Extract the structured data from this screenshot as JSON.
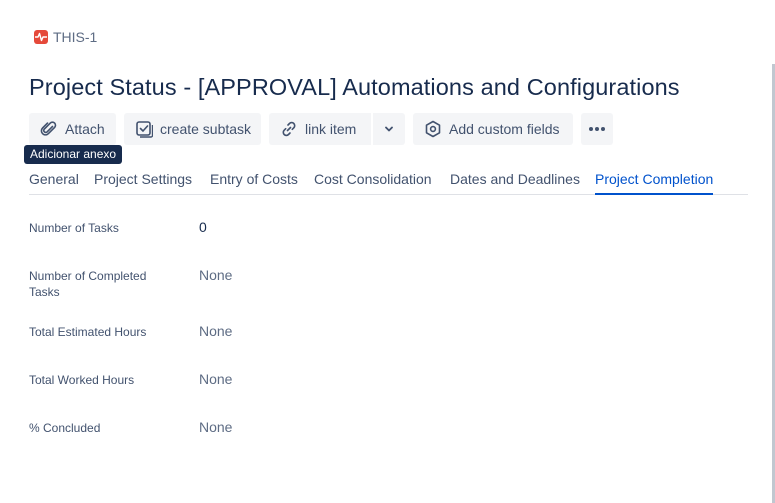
{
  "breadcrumb": {
    "issue_key": "THIS-1",
    "icon": "pulse-icon",
    "icon_color": "#e5493a"
  },
  "page": {
    "title": "Project Status - [APPROVAL] Automations and Configurations"
  },
  "toolbar": {
    "attach_label": "Attach",
    "create_subtask_label": "create subtask",
    "link_item_label": "link item",
    "add_custom_fields_label": "Add custom fields",
    "tooltip": "Adicionar anexo"
  },
  "tabs": [
    {
      "label": "General",
      "active": false
    },
    {
      "label": "Project Settings",
      "active": false
    },
    {
      "label": "Entry of Costs",
      "active": false
    },
    {
      "label": "Cost Consolidation",
      "active": false
    },
    {
      "label": "Dates and Deadlines",
      "active": false
    },
    {
      "label": "Project Completion",
      "active": true
    }
  ],
  "fields": [
    {
      "label": "Number of Tasks",
      "value": "0"
    },
    {
      "label": "Number of Completed Tasks",
      "value": "None"
    },
    {
      "label": "Total Estimated Hours",
      "value": "None"
    },
    {
      "label": "Total Worked Hours",
      "value": "None"
    },
    {
      "label": "% Concluded",
      "value": "None"
    }
  ],
  "colors": {
    "accent": "#0052cc",
    "text": "#172b4d",
    "muted": "#5e6c84"
  }
}
